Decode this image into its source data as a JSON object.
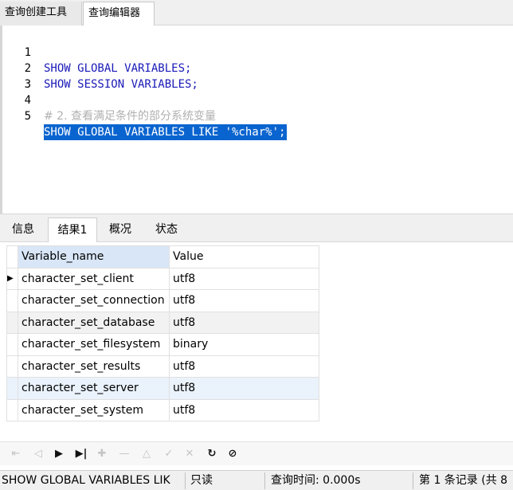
{
  "tabs": {
    "query_builder": "查询创建工具",
    "query_editor": "查询编辑器"
  },
  "editor": {
    "lines": [
      {
        "num": "1",
        "text": "SHOW GLOBAL VARIABLES;"
      },
      {
        "num": "2",
        "text": "SHOW SESSION VARIABLES;"
      },
      {
        "num": "3",
        "text": ""
      },
      {
        "num": "4",
        "text": "# 2. 查看满足条件的部分系统变量"
      },
      {
        "num": "5",
        "text": "SHOW GLOBAL VARIABLES LIKE '%char%';"
      }
    ]
  },
  "result_tabs": [
    "信息",
    "结果1",
    "概况",
    "状态"
  ],
  "grid": {
    "columns": [
      "Variable_name",
      "Value"
    ],
    "rows": [
      [
        "character_set_client",
        "utf8"
      ],
      [
        "character_set_connection",
        "utf8"
      ],
      [
        "character_set_database",
        "utf8"
      ],
      [
        "character_set_filesystem",
        "binary"
      ],
      [
        "character_set_results",
        "utf8"
      ],
      [
        "character_set_server",
        "utf8"
      ],
      [
        "character_set_system",
        "utf8"
      ]
    ],
    "row_marker": "▶"
  },
  "navbar": {
    "icons": [
      "first-record-icon",
      "prev-record-icon",
      "next-record-icon",
      "last-record-icon",
      "add-record-icon",
      "delete-record-icon",
      "apply-icon",
      "discard-icon",
      "cancel-icon",
      "refresh-icon",
      "stop-icon"
    ],
    "glyphs": [
      "⇤",
      "◁",
      "▶",
      "▶|",
      "✚",
      "—",
      "△",
      "✓",
      "✕",
      "↻",
      "⊘"
    ]
  },
  "statusbar": {
    "query": "SHOW GLOBAL VARIABLES LIK",
    "mode": "只读",
    "time": "查询时间: 0.000s",
    "records": "第 1 条记录 (共 8"
  },
  "colors": {
    "keyword": "#1a1ab8",
    "selection": "#0a64cf",
    "comment": "#b0b0b0"
  }
}
